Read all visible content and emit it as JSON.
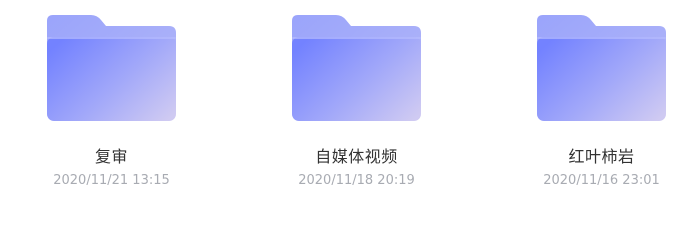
{
  "folders": [
    {
      "name": "复审",
      "date": "2020/11/21 13:15"
    },
    {
      "name": "自媒体视频",
      "date": "2020/11/18 20:19"
    },
    {
      "name": "红叶柿岩",
      "date": "2020/11/16 23:01"
    }
  ],
  "icon": "folder-icon",
  "colors": {
    "folder_tab": "#9fa9fb",
    "folder_front_start": "#7382ff",
    "folder_front_end": "#cdc8f3",
    "name_text": "#333333",
    "date_text": "#a8abb2"
  }
}
